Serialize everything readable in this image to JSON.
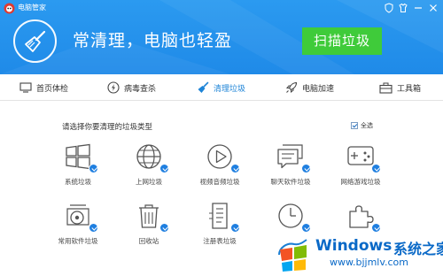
{
  "app": {
    "title": "电脑管家"
  },
  "header": {
    "headline": "常清理，电脑也轻盈",
    "scan_button": "扫描垃圾"
  },
  "nav": {
    "items": [
      {
        "label": "首页体检",
        "icon": "monitor-icon",
        "active": false
      },
      {
        "label": "病毒查杀",
        "icon": "lightning-icon",
        "active": false
      },
      {
        "label": "清理垃圾",
        "icon": "broom-icon",
        "active": true
      },
      {
        "label": "电脑加速",
        "icon": "rocket-icon",
        "active": false
      },
      {
        "label": "工具箱",
        "icon": "toolbox-icon",
        "active": false
      }
    ]
  },
  "content": {
    "prompt": "请选择你要清理的垃圾类型",
    "select_all": {
      "label": "全选",
      "checked": true
    },
    "categories": [
      {
        "label": "系统垃圾",
        "icon": "windows-icon",
        "checked": true
      },
      {
        "label": "上网垃圾",
        "icon": "globe-icon",
        "checked": true
      },
      {
        "label": "视频音频垃圾",
        "icon": "media-play-icon",
        "checked": true
      },
      {
        "label": "聊天软件垃圾",
        "icon": "chat-icon",
        "checked": true
      },
      {
        "label": "网络游戏垃圾",
        "icon": "gamepad-icon",
        "checked": true
      },
      {
        "label": "常用软件垃圾",
        "icon": "disc-icon",
        "checked": true
      },
      {
        "label": "回收站",
        "icon": "trash-icon",
        "checked": true
      },
      {
        "label": "注册表垃圾",
        "icon": "registry-document-icon",
        "checked": true
      },
      {
        "label": "",
        "icon": "clock-icon",
        "checked": true
      },
      {
        "label": "",
        "icon": "puzzle-icon",
        "checked": true
      }
    ]
  },
  "watermark": {
    "brand": "Windows",
    "site_name": "系统之家",
    "url": "www.bjjmlv.com"
  },
  "colors": {
    "header_blue": "#2196f0",
    "scan_green": "#3fcb3a",
    "active_nav": "#1e84d7",
    "badge_blue": "#1f7fe0"
  }
}
